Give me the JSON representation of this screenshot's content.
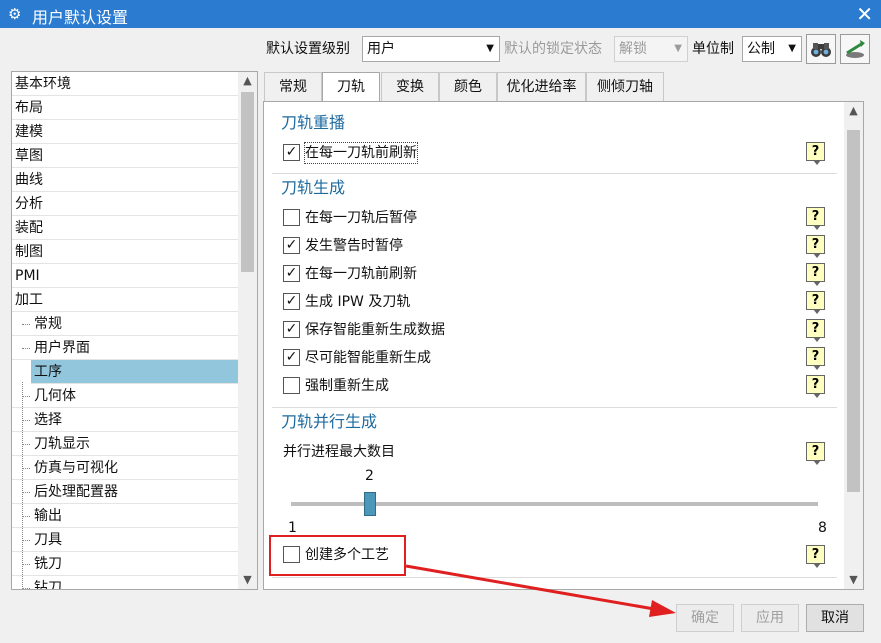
{
  "window": {
    "title": "用户默认设置",
    "app_icon": "gear-icon",
    "close_icon": "close-icon"
  },
  "toolbar": {
    "level_label": "默认设置级别",
    "level_value": "用户",
    "lock_state_label": "默认的锁定状态",
    "lock_state_value": "解锁",
    "unit_label": "单位制",
    "unit_value": "公制",
    "btn1_icon": "binoculars-icon",
    "btn2_icon": "import-settings-icon"
  },
  "tree": {
    "items": [
      {
        "label": "基本环境",
        "level": 0
      },
      {
        "label": "布局",
        "level": 0
      },
      {
        "label": "建模",
        "level": 0
      },
      {
        "label": "草图",
        "level": 0
      },
      {
        "label": "曲线",
        "level": 0
      },
      {
        "label": "分析",
        "level": 0
      },
      {
        "label": "装配",
        "level": 0
      },
      {
        "label": "制图",
        "level": 0
      },
      {
        "label": "PMI",
        "level": 0
      },
      {
        "label": "加工",
        "level": 0
      },
      {
        "label": "常规",
        "level": 1
      },
      {
        "label": "用户界面",
        "level": 1
      },
      {
        "label": "工序",
        "level": 1,
        "selected": true
      },
      {
        "label": "几何体",
        "level": 1
      },
      {
        "label": "选择",
        "level": 1
      },
      {
        "label": "刀轨显示",
        "level": 1
      },
      {
        "label": "仿真与可视化",
        "level": 1
      },
      {
        "label": "后处理配置器",
        "level": 1
      },
      {
        "label": "输出",
        "level": 1
      },
      {
        "label": "刀具",
        "level": 1
      },
      {
        "label": "铣刀",
        "level": 1
      },
      {
        "label": "钻刀",
        "level": 1
      }
    ]
  },
  "tabs": [
    {
      "label": "常规"
    },
    {
      "label": "刀轨",
      "active": true
    },
    {
      "label": "变换"
    },
    {
      "label": "颜色"
    },
    {
      "label": "优化进给率"
    },
    {
      "label": "侧倾刀轴"
    }
  ],
  "content": {
    "replay": {
      "title": "刀轨重播",
      "items": [
        {
          "label": "在每一刀轨前刷新",
          "checked": true
        }
      ]
    },
    "generate": {
      "title": "刀轨生成",
      "items": [
        {
          "label": "在每一刀轨后暂停",
          "checked": false
        },
        {
          "label": "发生警告时暂停",
          "checked": true
        },
        {
          "label": "在每一刀轨前刷新",
          "checked": true
        },
        {
          "label": "生成 IPW 及刀轨",
          "checked": true
        },
        {
          "label": "保存智能重新生成数据",
          "checked": true
        },
        {
          "label": "尽可能智能重新生成",
          "checked": true
        },
        {
          "label": "强制重新生成",
          "checked": false
        }
      ]
    },
    "parallel": {
      "title": "刀轨并行生成",
      "max_label": "并行进程最大数目",
      "slider_value": 2,
      "slider_min": 1,
      "slider_max": 8,
      "create_multi": {
        "label": "创建多个工艺",
        "checked": false
      }
    },
    "help_icon": "help-icon"
  },
  "buttons": {
    "ok": "确定",
    "apply": "应用",
    "cancel": "取消"
  },
  "colors": {
    "titlebar": "#2b7bd0",
    "highlight": "#e02020",
    "selection": "#91c6dc",
    "section_title": "#1e6ba0"
  }
}
